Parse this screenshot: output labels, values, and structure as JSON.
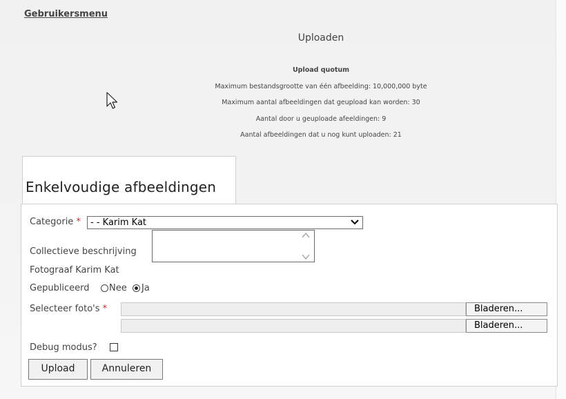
{
  "header": {
    "user_menu": "Gebruikersmenu",
    "upload_title": "Uploaden"
  },
  "quota": {
    "title": "Upload quotum",
    "max_file_size": "Maximum bestandsgrootte van één afbeelding: 10,000,000 byte",
    "max_images": "Maximum aantal afbeeldingen dat geupload kan worden: 30",
    "uploaded": "Aantal door u geuploade afeeldingen: 9",
    "remaining": "Aantal afbeeldingen dat u nog kunt uploaden: 21"
  },
  "tab": {
    "label": "Enkelvoudige afbeeldingen"
  },
  "form": {
    "category_label": "Categorie",
    "required_mark": "*",
    "category_value": "- - Karim Kat",
    "description_label": "Collectieve beschrijving",
    "photographer_label": "Fotograaf",
    "photographer_value": "Karim Kat",
    "published_label": "Gepubliceerd",
    "published_options": [
      "Nee",
      "Ja"
    ],
    "published_selected": "Ja",
    "select_photos_label": "Selecteer foto's",
    "browse_label": "Bladeren...",
    "debug_label": "Debug modus?",
    "upload_button": "Upload",
    "cancel_button": "Annuleren"
  }
}
